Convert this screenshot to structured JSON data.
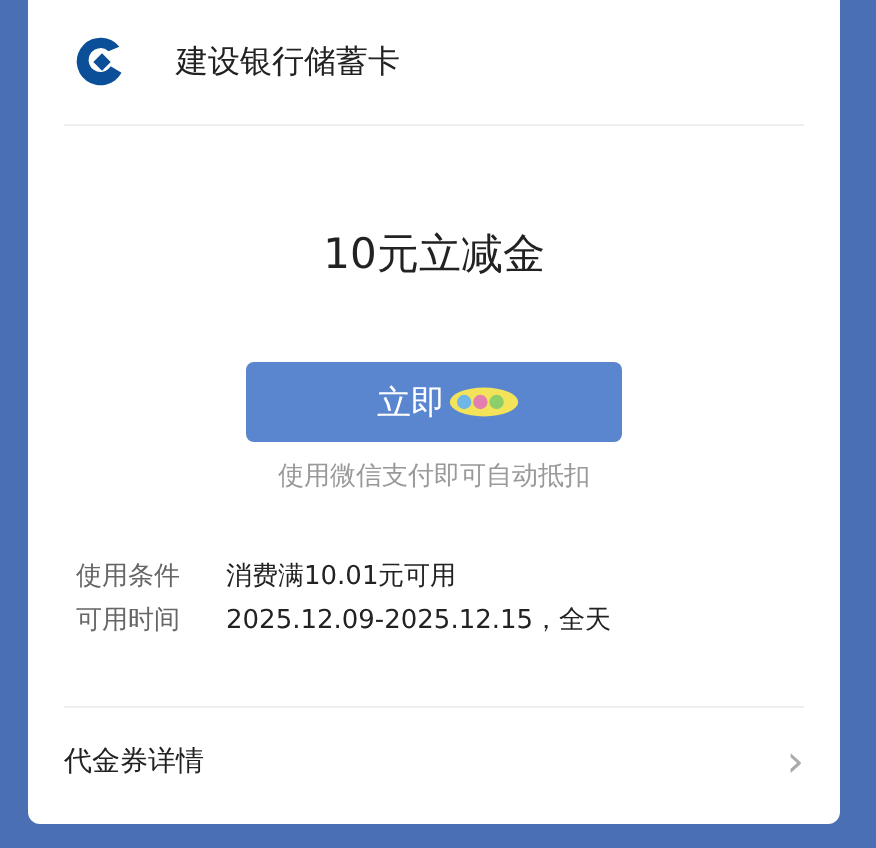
{
  "header": {
    "bank_name": "建设银行储蓄卡"
  },
  "coupon": {
    "title": "10元立减金",
    "button": "立即",
    "hint": "使用微信支付即可自动抵扣"
  },
  "info": [
    {
      "label": "使用条件",
      "value": "消费满10.01元可用"
    },
    {
      "label": "可用时间",
      "value": "2025.12.09-2025.12.15，全天"
    }
  ],
  "details": {
    "label": "代金券详情",
    "chevron": "›"
  }
}
